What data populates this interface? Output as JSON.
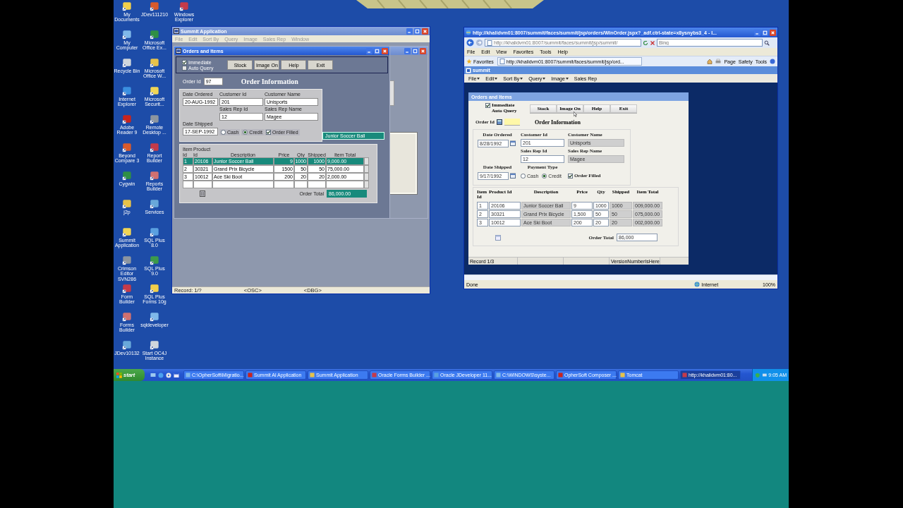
{
  "desktop": {
    "icon_columns": [
      [
        {
          "label": "My Documents"
        },
        {
          "label": "My Computer"
        },
        {
          "label": "Recycle Bin"
        },
        {
          "label": "Internet Explorer"
        },
        {
          "label": "Adobe Reader 9"
        },
        {
          "label": "Beyond Compare 3"
        },
        {
          "label": "Cygwin"
        },
        {
          "label": "j2p"
        },
        {
          "label": "Summit Application"
        },
        {
          "label": "Crimson Editor SVN286"
        },
        {
          "label": "Form Builder"
        },
        {
          "label": "Forms Builder"
        },
        {
          "label": "JDev10132"
        }
      ],
      [
        {
          "label": "JDev111210"
        },
        {
          "label": "Microsoft Office Ex..."
        },
        {
          "label": "Microsoft Office W..."
        },
        {
          "label": "Microsoft Securit..."
        },
        {
          "label": "Remote Desktop ..."
        },
        {
          "label": "Report Builder"
        },
        {
          "label": "Reports Builder"
        },
        {
          "label": "Services"
        },
        {
          "label": "SQL Plus 8.0"
        },
        {
          "label": "SQL Plus 9.0"
        },
        {
          "label": "SQL Plus Forms 10g"
        },
        {
          "label": "sqldeveloper"
        },
        {
          "label": "Start OC4J Instance"
        }
      ],
      [
        {
          "label": "Windows Explorer"
        }
      ]
    ]
  },
  "forms_window": {
    "title": "Summit Application",
    "menu": [
      "File",
      "Edit",
      "Sort By",
      "Query",
      "Image",
      "Sales Rep",
      "Window"
    ],
    "form": {
      "title": "Orders and Items",
      "options": [
        {
          "label": "Immediate",
          "checked": true
        },
        {
          "label": "Auto Query",
          "checked": false
        }
      ],
      "buttons": [
        "Stock",
        "Image On",
        "Help",
        "Exit"
      ],
      "order_id": {
        "label": "Order Id",
        "value": "97"
      },
      "heading": "Order Information",
      "date_ordered": {
        "label": "Date Ordered",
        "value": "20-AUG-1992"
      },
      "customer_id": {
        "label": "Customer Id",
        "value": "201"
      },
      "customer_name": {
        "label": "Customer Name",
        "value": "Unisports"
      },
      "sales_rep_id": {
        "label": "Sales Rep Id",
        "value": "12"
      },
      "sales_rep_name": {
        "label": "Sales Rep Name",
        "value": "Magee"
      },
      "date_shipped": {
        "label": "Date Shipped",
        "value": "17-SEP-1992"
      },
      "payment": [
        {
          "label": "Cash",
          "selected": false
        },
        {
          "label": "Credit",
          "selected": true
        }
      ],
      "order_filled": {
        "label": "Order Filled",
        "checked": true
      },
      "description_hint": "Junior Soccer Ball",
      "items": {
        "columns": [
          "Item Id",
          "Product Id",
          "Description",
          "Price",
          "Qty",
          "Shipped",
          "Item Total"
        ],
        "rows": [
          {
            "cells": [
              "1",
              "20106",
              "Junior Soccer Ball",
              "9",
              "1000",
              "1000",
              "9,000.00"
            ],
            "selected": true
          },
          {
            "cells": [
              "2",
              "30321",
              "Grand Prix Bicycle",
              "1500",
              "50",
              "50",
              "75,000.00"
            ],
            "selected": false
          },
          {
            "cells": [
              "3",
              "10012",
              "Ace Ski Boot",
              "200",
              "20",
              "20",
              "2,000.00"
            ],
            "selected": false
          }
        ]
      },
      "order_total": {
        "label": "Order Total",
        "value": "86,000.00"
      }
    },
    "status_bar": [
      "Record: 1/?",
      "<OSC>",
      "<DBG>"
    ]
  },
  "browser_window": {
    "title": "http://khalidvm01:8007/summit/faces/summit/jsp/orders/WinOrder.jspx?_adf.ctrl-state=x8ysnybs3_4 - I...",
    "address": "http://khalidvm01:8007/summit/faces/summit/jsp/summit/",
    "search_placeholder": "Bing",
    "menu": [
      "File",
      "Edit",
      "View",
      "Favorites",
      "Tools",
      "Help"
    ],
    "favorites": "Favorites",
    "tab": "http://khalidvm01:8007/summit/faces/summit/jsp/ord...",
    "commands": [
      "Page",
      "Safety",
      "Tools"
    ],
    "app": {
      "title": "summit",
      "menu": [
        {
          "label": "File",
          "dropdown": true
        },
        {
          "label": "Edit",
          "dropdown": true
        },
        {
          "label": "Sort By",
          "dropdown": true
        },
        {
          "label": "Query",
          "dropdown": true
        },
        {
          "label": "Image",
          "dropdown": true
        },
        {
          "label": "Sales Rep",
          "dropdown": false
        }
      ],
      "form": {
        "title": "Orders and Items",
        "auto_query": {
          "label": "Immediate Auto Query",
          "checked": true
        },
        "buttons": [
          "Stock",
          "Image On",
          "Help",
          "Exit"
        ],
        "order_id": {
          "label": "Order Id"
        },
        "heading": "Order Information",
        "date_ordered": {
          "label": "Date Ordered",
          "value": "8/28/1992"
        },
        "customer_id": {
          "label": "Customer Id",
          "value": "201"
        },
        "customer_name": {
          "label": "Customer Name",
          "value": "Unisports"
        },
        "sales_rep_id": {
          "label": "Sales Rep Id",
          "value": "12"
        },
        "sales_rep_name": {
          "label": "Sales Rep Name",
          "value": "Magee"
        },
        "date_shipped": {
          "label": "Date Shipped",
          "value": "9/17/1992"
        },
        "payment_label": "Payment Type",
        "payment": [
          {
            "label": "Cash",
            "selected": false
          },
          {
            "label": "Credit",
            "selected": true
          }
        ],
        "order_filled": {
          "label": "Order Filled",
          "checked": true
        },
        "items": {
          "columns": [
            "Item Id",
            "Product Id",
            "Description",
            "Price",
            "Qty",
            "Shipped",
            "Item Total"
          ],
          "rows": [
            {
              "cells": [
                "1",
                "20106",
                "Junior Soccer Ball",
                "9",
                "1000",
                "1000",
                "009,000.00"
              ]
            },
            {
              "cells": [
                "2",
                "30321",
                "Grand Prix Bicycle",
                "1,500",
                "50",
                "50",
                "075,000.00"
              ]
            },
            {
              "cells": [
                "3",
                "10012",
                "Ace Ski Boot",
                "200",
                "20",
                "20",
                "002,000.00"
              ]
            }
          ]
        },
        "order_total": {
          "label": "Order Total",
          "value": "86,000"
        },
        "status_bar": [
          "Record 1/3",
          "VersionNumberIsHere"
        ]
      }
    },
    "status": "Done",
    "zone": "Internet",
    "zoom": "100%"
  },
  "taskbar": {
    "start": "start",
    "tasks": [
      {
        "label": "C:\\OpherSoft\\Migratio...",
        "selected": false
      },
      {
        "label": "Summit Al Application",
        "selected": false
      },
      {
        "label": "Summit Application",
        "selected": false
      },
      {
        "label": "Oracle Forms Builder ...",
        "selected": false
      },
      {
        "label": "Oracle JDeveloper 11...",
        "selected": false
      },
      {
        "label": "C:\\WINDOWS\\syste...",
        "selected": false
      },
      {
        "label": "OpherSoft Composer ...",
        "selected": false
      },
      {
        "label": "Tomcat",
        "selected": false
      },
      {
        "label": "http://khalidvm01:80...",
        "selected": true
      }
    ],
    "clock": "9:05 AM"
  }
}
